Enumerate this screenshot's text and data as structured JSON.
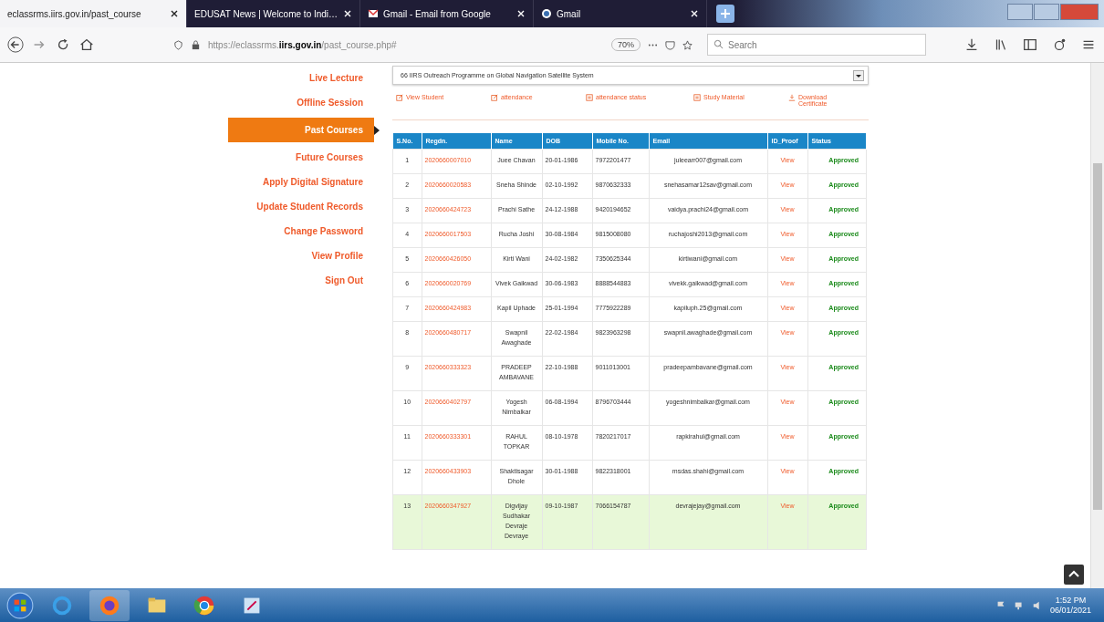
{
  "browser": {
    "tabs": [
      {
        "title": "eclassrms.iirs.gov.in/past_course",
        "selected": true
      },
      {
        "title": "EDUSAT News | Welcome to Indi…",
        "selected": false
      },
      {
        "title": "Gmail - Email from Google",
        "selected": false
      },
      {
        "title": "Gmail",
        "selected": false
      }
    ],
    "url_prefix": "https://eclassrms.",
    "url_domain": "iirs.gov.in",
    "url_path": "/past_course.php#",
    "zoom": "70%",
    "search": {
      "placeholder": "Search"
    }
  },
  "sidebar": {
    "items": [
      {
        "label": "Live Lecture",
        "selected": false
      },
      {
        "label": "Offline Session",
        "selected": false
      },
      {
        "label": "Past Courses",
        "selected": true
      },
      {
        "label": "Future Courses",
        "selected": false
      },
      {
        "label": "Apply Digital Signature",
        "selected": false
      },
      {
        "label": "Update Student Records",
        "selected": false
      },
      {
        "label": "Change Password",
        "selected": false
      },
      {
        "label": "View Profile",
        "selected": false
      },
      {
        "label": "Sign Out",
        "selected": false
      }
    ]
  },
  "course_select": {
    "value": "66 IIRS Outreach Programme on Global Navigation Satellite System"
  },
  "actions": [
    {
      "label": "View Student",
      "kind": "edit"
    },
    {
      "label": "attendance",
      "kind": "edit"
    },
    {
      "label": "attendance status",
      "kind": "list"
    },
    {
      "label": "Study Material",
      "kind": "list"
    },
    {
      "label": "Download Certificate",
      "kind": "download"
    }
  ],
  "table": {
    "columns": [
      "S.No.",
      "Regdn.",
      "Name",
      "DOB",
      "Mobile No.",
      "Email",
      "ID_Proof",
      "Status"
    ],
    "rows": [
      {
        "sno": "1",
        "regdn": "2020660007010",
        "name": "Juee Chavan",
        "dob": "20-01-1986",
        "mobile": "7972201477",
        "email": "juleearr007@gmail.com",
        "id_proof": "View",
        "status": "Approved",
        "highlighted": false
      },
      {
        "sno": "2",
        "regdn": "2020660020583",
        "name": "Sneha Shinde",
        "dob": "02-10-1992",
        "mobile": "9870632333",
        "email": "snehasamar12sav@gmail.com",
        "id_proof": "View",
        "status": "Approved",
        "highlighted": false
      },
      {
        "sno": "3",
        "regdn": "2020660424723",
        "name": "Prachi Sathe",
        "dob": "24-12-1988",
        "mobile": "9420194652",
        "email": "vaidya.prachi24@gmail.com",
        "id_proof": "View",
        "status": "Approved",
        "highlighted": false
      },
      {
        "sno": "4",
        "regdn": "2020660017503",
        "name": "Rucha Joshi",
        "dob": "30-08-1984",
        "mobile": "9815008080",
        "email": "ruchajoshi2013@gmail.com",
        "id_proof": "View",
        "status": "Approved",
        "highlighted": false
      },
      {
        "sno": "5",
        "regdn": "2020660426050",
        "name": "Kirti Wani",
        "dob": "24-02-1982",
        "mobile": "7350625344",
        "email": "kirtiwani@gmail.com",
        "id_proof": "View",
        "status": "Approved",
        "highlighted": false
      },
      {
        "sno": "6",
        "regdn": "2020660020769",
        "name": "Vivek Gaikwad",
        "dob": "30-06-1983",
        "mobile": "8888544883",
        "email": "vivekk.gaikwad@gmail.com",
        "id_proof": "View",
        "status": "Approved",
        "highlighted": false
      },
      {
        "sno": "7",
        "regdn": "2020660424983",
        "name": "Kapil Uphade",
        "dob": "25-01-1994",
        "mobile": "7775922289",
        "email": "kapiluph.25@gmail.com",
        "id_proof": "View",
        "status": "Approved",
        "highlighted": false
      },
      {
        "sno": "8",
        "regdn": "2020660480717",
        "name": "Swapnil Awaghade",
        "dob": "22-02-1984",
        "mobile": "9823963298",
        "email": "swapnil.awaghade@gmail.com",
        "id_proof": "View",
        "status": "Approved",
        "highlighted": false
      },
      {
        "sno": "9",
        "regdn": "2020660333323",
        "name": "PRADEEP AMBAVANE",
        "dob": "22-10-1988",
        "mobile": "9011013001",
        "email": "pradeepambavane@gmail.com",
        "id_proof": "View",
        "status": "Approved",
        "highlighted": false
      },
      {
        "sno": "10",
        "regdn": "2020660402797",
        "name": "Yogesh Nimbalkar",
        "dob": "06-08-1994",
        "mobile": "8796703444",
        "email": "yogeshnimbalkar@gmail.com",
        "id_proof": "View",
        "status": "Approved",
        "highlighted": false
      },
      {
        "sno": "11",
        "regdn": "2020660333301",
        "name": "RAHUL TOPKAR",
        "dob": "08-10-1978",
        "mobile": "7820217017",
        "email": "rapkirahul@gmail.com",
        "id_proof": "View",
        "status": "Approved",
        "highlighted": false
      },
      {
        "sno": "12",
        "regdn": "2020660433903",
        "name": "Shaktisagar Dhole",
        "dob": "30-01-1988",
        "mobile": "9822318001",
        "email": "msdas.shahi@gmail.com",
        "id_proof": "View",
        "status": "Approved",
        "highlighted": false
      },
      {
        "sno": "13",
        "regdn": "2020660347927",
        "name": "Digvijay Sudhakar Devraje Devraye",
        "dob": "09-10-1987",
        "mobile": "7066154787",
        "email": "devrajejay@gmail.com",
        "id_proof": "View",
        "status": "Approved",
        "highlighted": true
      }
    ]
  },
  "taskbar": {
    "time": "1:52 PM",
    "date": "06/01/2021"
  }
}
